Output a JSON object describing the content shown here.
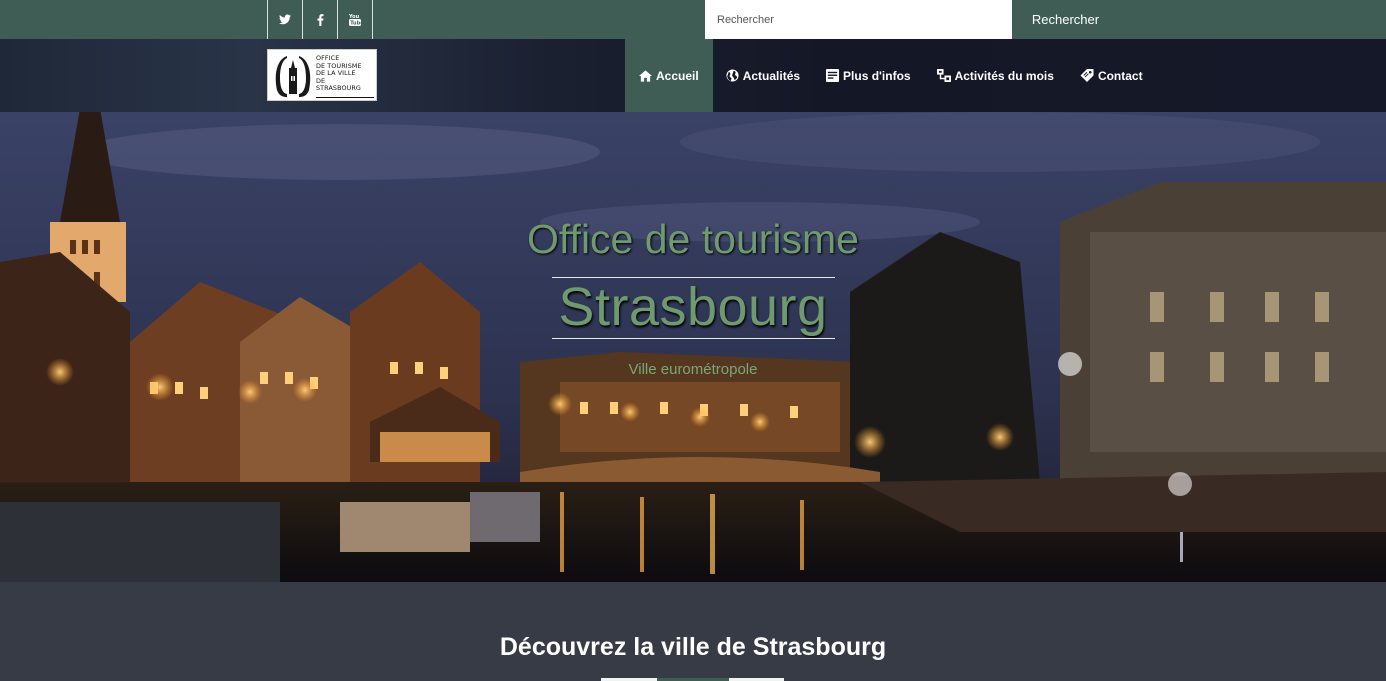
{
  "topbar": {
    "social": [
      {
        "name": "twitter-icon"
      },
      {
        "name": "facebook-icon"
      },
      {
        "name": "youtube-icon"
      }
    ],
    "search": {
      "placeholder": "Rechercher",
      "button_label": "Rechercher"
    }
  },
  "logo": {
    "text": "OFFICE\nDE TOURISME\nDE LA VILLE\nDE\nSTRASBOURG"
  },
  "nav": {
    "items": [
      {
        "label": "Accueil",
        "icon": "home-icon",
        "active": true
      },
      {
        "label": "Actualités",
        "icon": "globe-icon",
        "active": false
      },
      {
        "label": "Plus d'infos",
        "icon": "document-icon",
        "active": false
      },
      {
        "label": "Activités du mois",
        "icon": "activities-icon",
        "active": false
      },
      {
        "label": "Contact",
        "icon": "tag-icon",
        "active": false
      }
    ]
  },
  "hero": {
    "title": "Office de tourisme",
    "city": "Strasbourg",
    "subtitle": "Ville eurométropole"
  },
  "section": {
    "title": "Découvrez la ville de Strasbourg"
  },
  "colors": {
    "brand_green": "#3f5d55",
    "hero_text": "#6f9a6f",
    "page_bg": "#363b45"
  }
}
